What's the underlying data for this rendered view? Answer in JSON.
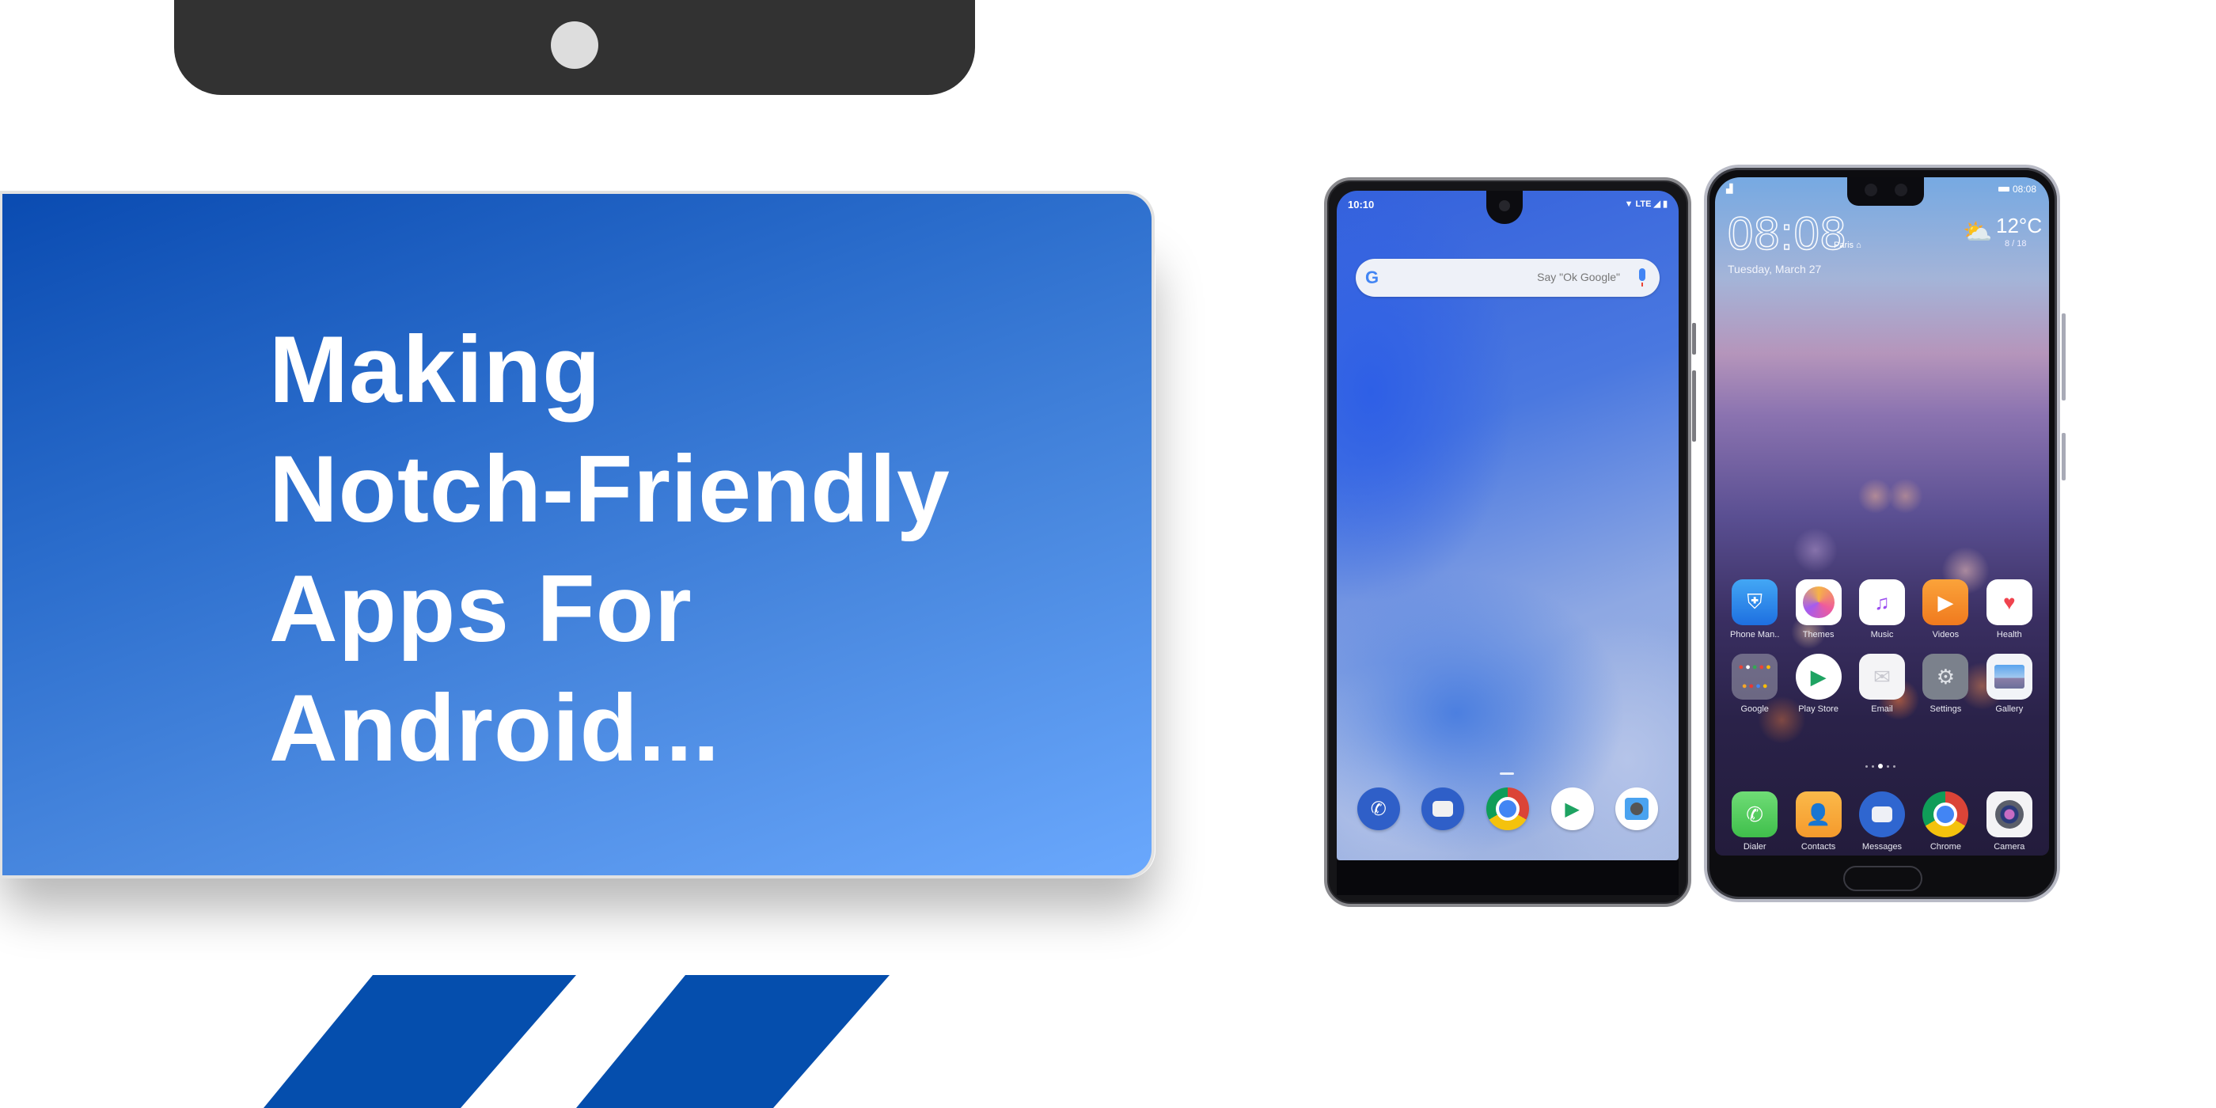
{
  "headline": {
    "lines": [
      "Making",
      "Notch-Friendly",
      "Apps For",
      "Android..."
    ]
  },
  "colors": {
    "card_gradient_start": "#0a4bb1",
    "card_gradient_end": "#6aa8fd",
    "stripe": "#054ead",
    "notch_decoration": "#323232",
    "notch_camera": "#dddddd"
  },
  "phone_left": {
    "status_time": "10:10",
    "status_icons": [
      "wifi-icon",
      "LTE",
      "signal-icon",
      "battery-icon"
    ],
    "status_network": "LTE",
    "search": {
      "logo": "G",
      "placeholder": "Say \"Ok Google\"",
      "mic_icon": "mic-icon"
    },
    "dock": [
      {
        "name": "phone",
        "icon": "phone-icon"
      },
      {
        "name": "messages",
        "icon": "messages-icon"
      },
      {
        "name": "chrome",
        "icon": "chrome-icon"
      },
      {
        "name": "play-store",
        "icon": "play-store-icon"
      },
      {
        "name": "camera",
        "icon": "camera-icon"
      }
    ]
  },
  "phone_right": {
    "status_time": "08:08",
    "clock": "08:08",
    "city": "Paris",
    "date": "Tuesday, March 27",
    "temperature": "12°C",
    "temp_range": "8 / 18",
    "page_indicator": {
      "count": 5,
      "active_index": 2
    },
    "apps": [
      {
        "label": "Phone Man..",
        "icon": "shield-icon"
      },
      {
        "label": "Themes",
        "icon": "brush-icon"
      },
      {
        "label": "Music",
        "icon": "music-icon"
      },
      {
        "label": "Videos",
        "icon": "play-icon"
      },
      {
        "label": "Health",
        "icon": "heart-icon"
      },
      {
        "label": "Google",
        "icon": "folder-icon"
      },
      {
        "label": "Play Store",
        "icon": "play-store-icon"
      },
      {
        "label": "Email",
        "icon": "envelope-icon"
      },
      {
        "label": "Settings",
        "icon": "gear-icon"
      },
      {
        "label": "Gallery",
        "icon": "gallery-icon"
      }
    ],
    "dock": [
      {
        "label": "Dialer",
        "icon": "phone-icon"
      },
      {
        "label": "Contacts",
        "icon": "contact-icon"
      },
      {
        "label": "Messages",
        "icon": "messages-icon"
      },
      {
        "label": "Chrome",
        "icon": "chrome-icon"
      },
      {
        "label": "Camera",
        "icon": "camera-icon"
      }
    ]
  }
}
